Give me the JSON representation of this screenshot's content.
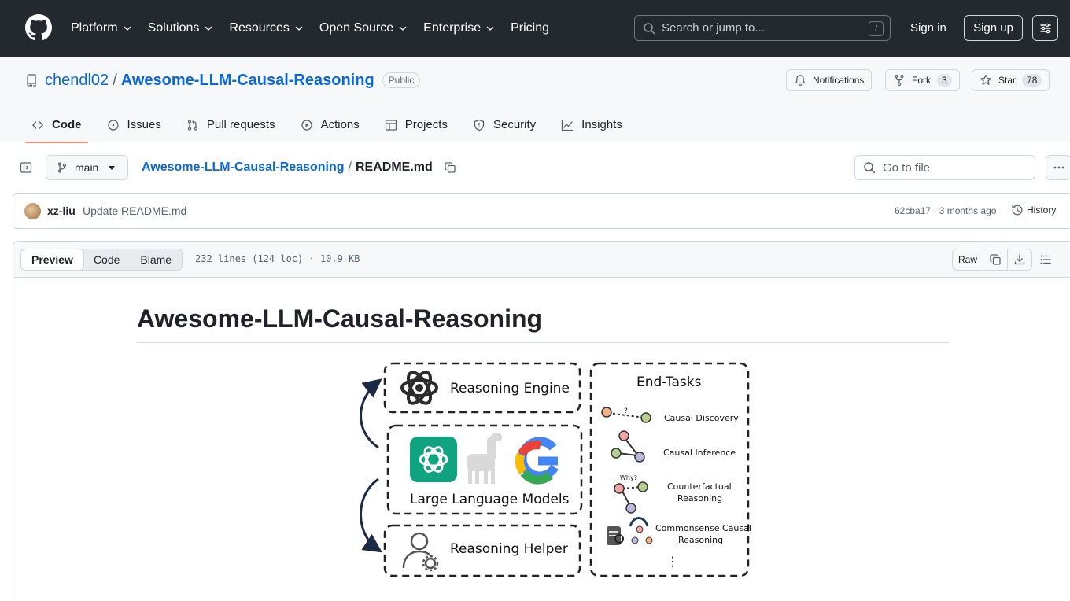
{
  "header": {
    "nav": [
      "Platform",
      "Solutions",
      "Resources",
      "Open Source",
      "Enterprise",
      "Pricing"
    ],
    "nav_has_dropdown": [
      true,
      true,
      true,
      true,
      true,
      false
    ],
    "search_placeholder": "Search or jump to...",
    "search_shortcut": "/",
    "sign_in": "Sign in",
    "sign_up": "Sign up"
  },
  "repo": {
    "owner": "chendl02",
    "separator": "/",
    "name": "Awesome-LLM-Causal-Reasoning",
    "visibility": "Public",
    "notifications_label": "Notifications",
    "fork_label": "Fork",
    "fork_count": "3",
    "star_label": "Star",
    "star_count": "78"
  },
  "tabs": [
    {
      "label": "Code",
      "icon": "code-icon",
      "active": true
    },
    {
      "label": "Issues",
      "icon": "issue-icon",
      "active": false
    },
    {
      "label": "Pull requests",
      "icon": "pull-request-icon",
      "active": false
    },
    {
      "label": "Actions",
      "icon": "play-icon",
      "active": false
    },
    {
      "label": "Projects",
      "icon": "table-icon",
      "active": false
    },
    {
      "label": "Security",
      "icon": "shield-icon",
      "active": false
    },
    {
      "label": "Insights",
      "icon": "graph-icon",
      "active": false
    }
  ],
  "file_nav": {
    "branch": "main",
    "breadcrumb_repo": "Awesome-LLM-Causal-Reasoning",
    "breadcrumb_sep": "/",
    "file_name": "README.md",
    "goto_placeholder": "Go to file"
  },
  "commit": {
    "author": "xz-liu",
    "message": "Update README.md",
    "hash_time": "62cba17 · 3 months ago",
    "history_label": "History"
  },
  "file": {
    "view_modes": [
      "Preview",
      "Code",
      "Blame"
    ],
    "active_mode": "Preview",
    "info": "232 lines (124 loc) · 10.9 KB",
    "raw_label": "Raw"
  },
  "readme": {
    "title": "Awesome-LLM-Causal-Reasoning",
    "figure": {
      "engine": "Reasoning Engine",
      "llms": "Large Language Models",
      "helper": "Reasoning Helper",
      "end_tasks_title": "End-Tasks",
      "tasks": [
        "Causal Discovery",
        "Causal Inference",
        "Counterfactual",
        "Reasoning",
        "Commonsense Causal",
        "Reasoning"
      ],
      "q_mark": "?",
      "why": "Why?",
      "more": "⋮"
    }
  },
  "colors": {
    "header_bg": "#24292f",
    "link": "#0969da",
    "active_tab_underline": "#fd8c73",
    "border": "#d0d7de"
  }
}
